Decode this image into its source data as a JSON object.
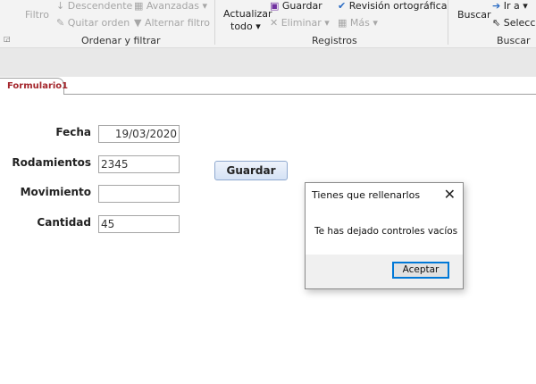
{
  "ribbon": {
    "filtro": "Filtro",
    "descendente": "Descendente",
    "quitar_orden": "Quitar orden",
    "avanzadas": "Avanzadas ▾",
    "alternar_filtro": "Alternar filtro",
    "group_sort": "Ordenar y filtrar",
    "actualizar": "Actualizar",
    "todo": "todo ▾",
    "guardar": "Guardar",
    "eliminar": "Eliminar",
    "mas": "Más ▾",
    "revision": "Revisión ortográfica",
    "group_records": "Registros",
    "buscar": "Buscar",
    "ir_a": "Ir a ▾",
    "seleccionar": "Seleccio",
    "group_find": "Buscar"
  },
  "tab": {
    "label": "Formulario1"
  },
  "form": {
    "fecha_label": "Fecha",
    "fecha_value": "19/03/2020",
    "rodamientos_label": "Rodamientos",
    "rodamientos_value": "2345",
    "movimiento_label": "Movimiento",
    "movimiento_value": "",
    "cantidad_label": "Cantidad",
    "cantidad_value": "45",
    "save_label": "Guardar"
  },
  "dialog": {
    "title": "Tienes que rellenarlos",
    "message": "Te has dejado controles vacíos",
    "ok_label": "Aceptar",
    "close": "✕"
  }
}
